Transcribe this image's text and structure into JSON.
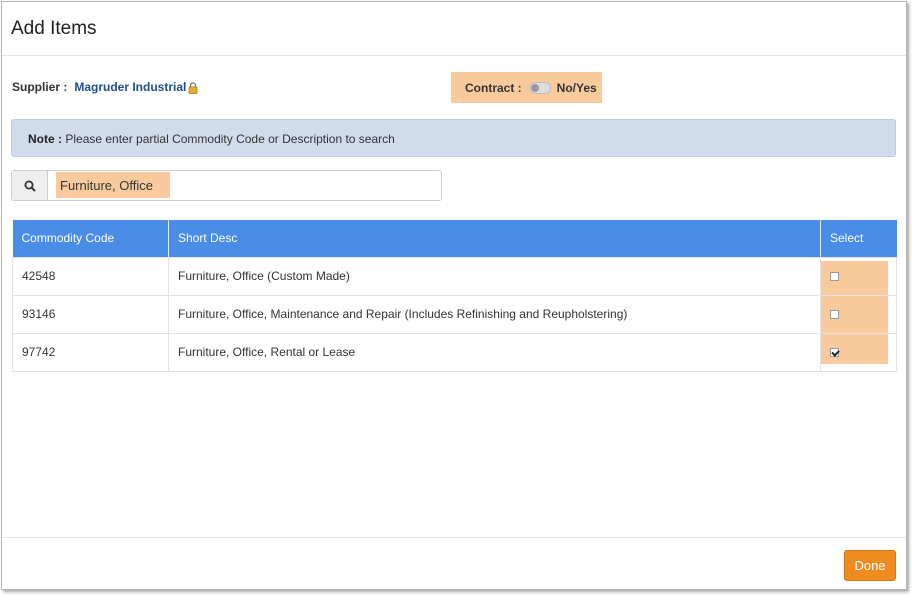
{
  "dialog": {
    "title": "Add Items"
  },
  "supplier": {
    "label": "Supplier :",
    "name": "Magruder Industrial",
    "icon": "lock-icon"
  },
  "contract": {
    "label": "Contract :",
    "toggle_label": "No/Yes",
    "value": false
  },
  "note": {
    "label": "Note :",
    "text": "Please enter partial Commodity Code or Description to search"
  },
  "search": {
    "icon": "search-icon",
    "value": "Furniture, Office"
  },
  "table": {
    "headers": [
      "Commodity Code",
      "Short Desc",
      "Select"
    ],
    "rows": [
      {
        "code": "42548",
        "desc": "Furniture, Office (Custom Made)",
        "selected": false
      },
      {
        "code": "93146",
        "desc": "Furniture, Office, Maintenance and Repair (Includes Refinishing and Reupholstering)",
        "selected": false
      },
      {
        "code": "97742",
        "desc": "Furniture, Office, Rental or Lease",
        "selected": true
      }
    ]
  },
  "footer": {
    "done_label": "Done"
  },
  "colors": {
    "header_blue": "#4a8de6",
    "highlight": "#f9cb9c",
    "done_orange": "#f08c1f",
    "note_bg": "#d0dcec"
  }
}
